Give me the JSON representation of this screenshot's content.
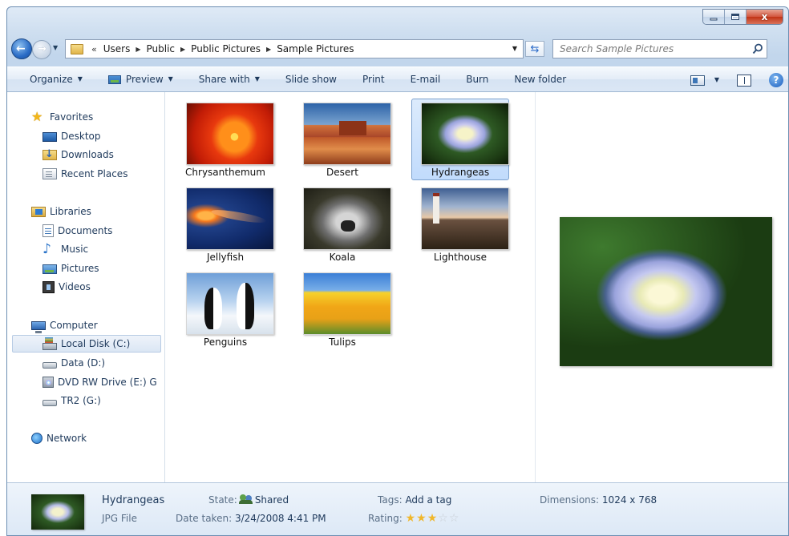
{
  "window": {
    "caption": {
      "minimize": "–",
      "maximize": "□",
      "close": "x"
    }
  },
  "address": {
    "overflow": "«",
    "crumbs": [
      "Users",
      "Public",
      "Public Pictures",
      "Sample Pictures"
    ]
  },
  "search": {
    "placeholder": "Search Sample Pictures"
  },
  "toolbar": {
    "organize": "Organize",
    "preview": "Preview",
    "share_with": "Share with",
    "slide_show": "Slide show",
    "print": "Print",
    "email": "E-mail",
    "burn": "Burn",
    "new_folder": "New folder",
    "help": "?"
  },
  "nav": {
    "favorites": "Favorites",
    "desktop": "Desktop",
    "downloads": "Downloads",
    "recent_places": "Recent Places",
    "libraries": "Libraries",
    "documents": "Documents",
    "music": "Music",
    "pictures": "Pictures",
    "videos": "Videos",
    "computer": "Computer",
    "local_disk": "Local Disk (C:)",
    "data_d": "Data (D:)",
    "dvd": "DVD RW Drive (E:) G",
    "tr2": "TR2 (G:)",
    "network": "Network"
  },
  "files": [
    {
      "name": "Chrysanthemum"
    },
    {
      "name": "Desert"
    },
    {
      "name": "Hydrangeas"
    },
    {
      "name": "Jellyfish"
    },
    {
      "name": "Koala"
    },
    {
      "name": "Lighthouse"
    },
    {
      "name": "Penguins"
    },
    {
      "name": "Tulips"
    }
  ],
  "selected_file": "Hydrangeas",
  "details": {
    "name": "Hydrangeas",
    "type": "JPG File",
    "state_label": "State:",
    "state_value": "Shared",
    "date_label": "Date taken:",
    "date_value": "3/24/2008 4:41 PM",
    "tags_label": "Tags:",
    "tags_value": "Add a tag",
    "rating_label": "Rating:",
    "rating_value": 3,
    "rating_max": 5,
    "dimensions_label": "Dimensions:",
    "dimensions_value": "1024 x 768"
  },
  "icons": {
    "back": "back-arrow-icon",
    "forward": "forward-arrow-icon",
    "refresh": "refresh-icon",
    "search": "search-icon"
  },
  "colors": {
    "accent": "#1e395b",
    "selection": "#c1dbfc",
    "selection_border": "#7da2ce"
  }
}
